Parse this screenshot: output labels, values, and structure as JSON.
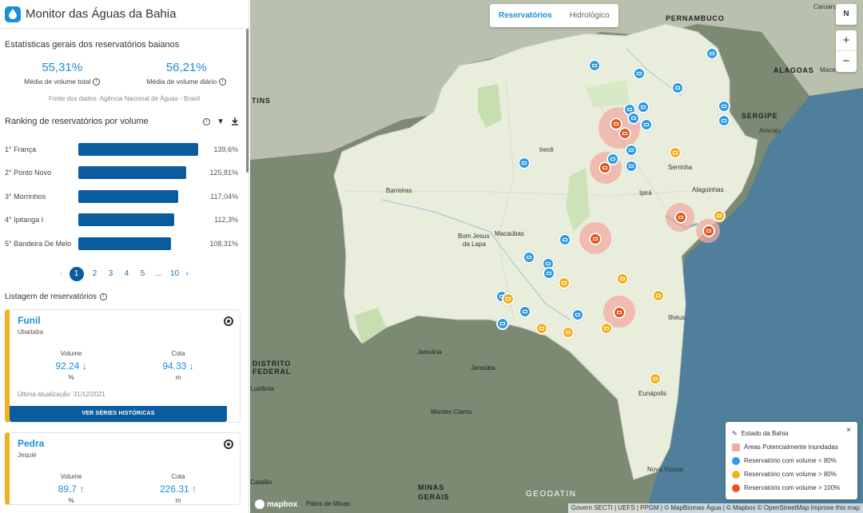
{
  "app": {
    "title": "Monitor das Águas da Bahia"
  },
  "stats": {
    "title": "Estatísticas gerais dos reservatórios baianos",
    "total_value": "55,31%",
    "total_label": "Média de volume total",
    "daily_value": "56,21%",
    "daily_label": "Média de volume diário",
    "source": "Fonte dos dados: Agência Nacional de Águas - Brasil"
  },
  "ranking": {
    "title": "Ranking de reservatórios por volume",
    "items": [
      {
        "label": "1° França",
        "value": "139,6%",
        "pct": 139.6
      },
      {
        "label": "2° Ponto Novo",
        "value": "125,81%",
        "pct": 125.81
      },
      {
        "label": "3° Morrinhos",
        "value": "117,04%",
        "pct": 117.04
      },
      {
        "label": "4° Ipitanga I",
        "value": "112,3%",
        "pct": 112.3
      },
      {
        "label": "5° Bandeira De Melo",
        "value": "108,31%",
        "pct": 108.31
      }
    ],
    "pages": [
      "1",
      "2",
      "3",
      "4",
      "5",
      "...",
      "10"
    ]
  },
  "listing": {
    "title": "Listagem de reservatórios",
    "cards": [
      {
        "name": "Funil",
        "city": "Ubaitaba",
        "volume_label": "Volume",
        "volume": "92.24",
        "volume_unit": "%",
        "cota_label": "Cota",
        "cota": "94.33",
        "cota_unit": "m",
        "update": "Última atualização: 31/12/2021",
        "button": "VER SÉRIES HISTÓRICAS"
      },
      {
        "name": "Pedra",
        "city": "Jequié",
        "volume_label": "Volume",
        "volume": "89.7",
        "volume_unit": "%",
        "cota_label": "Cota",
        "cota": "226.31",
        "cota_unit": "m"
      }
    ]
  },
  "map": {
    "tabs": {
      "active": "Reservatórios",
      "other": "Hidrológico"
    },
    "compass": "N",
    "zoom_in": "+",
    "zoom_out": "−",
    "labels": {
      "pernambuco": "PERNAMBUCO",
      "alagoas": "ALAGOAS",
      "sergipe": "SERGIPE",
      "tins": "TINS",
      "distrito1": "DISTRITO",
      "distrito2": "FEDERAL",
      "minas1": "MINAS",
      "minas2": "GERAIS",
      "caruaru": "Caruaru",
      "maceio": "Maceió",
      "aracaju": "Aracaju",
      "irece": "Irecê",
      "serrinha": "Serrinha",
      "alagoinhas": "Alagoinhas",
      "ipira": "Ipirá",
      "barreiras": "Barreiras",
      "bomjesus1": "Bom Jesus",
      "bomjesus2": "da Lapa",
      "macaubas": "Macaúbas",
      "ilheus": "Ilhéus",
      "januaria": "Januária",
      "janauba": "Janaúba",
      "luziania": "Luziânia",
      "montesclaros": "Montes Claros",
      "eunapolis": "Eunápolis",
      "novavicosa": "Nova Viçosa",
      "catalao": "Catalão",
      "patos": "Patos de Minas"
    },
    "legend": {
      "state": "Estado da Bahia",
      "areas": "Áreas Potencialmente Inundadas",
      "lt80": "Reservatório com volume < 80%",
      "gt80": "Reservatório com volume > 80%",
      "gt100": "Reservatório com volume > 100%",
      "close": "×"
    },
    "colors": {
      "lt80": "#2f9be0",
      "gt80": "#f2b01e",
      "gt100": "#e8531f",
      "flood": "#f2a9a3"
    },
    "mapbox": "mapbox",
    "geodatin": "GEODATIN",
    "attribution": "Govern SECTI | UEFS | PPGM | © MapBiomas Água | © Mapbox © OpenStreetMap  Improve this map"
  }
}
